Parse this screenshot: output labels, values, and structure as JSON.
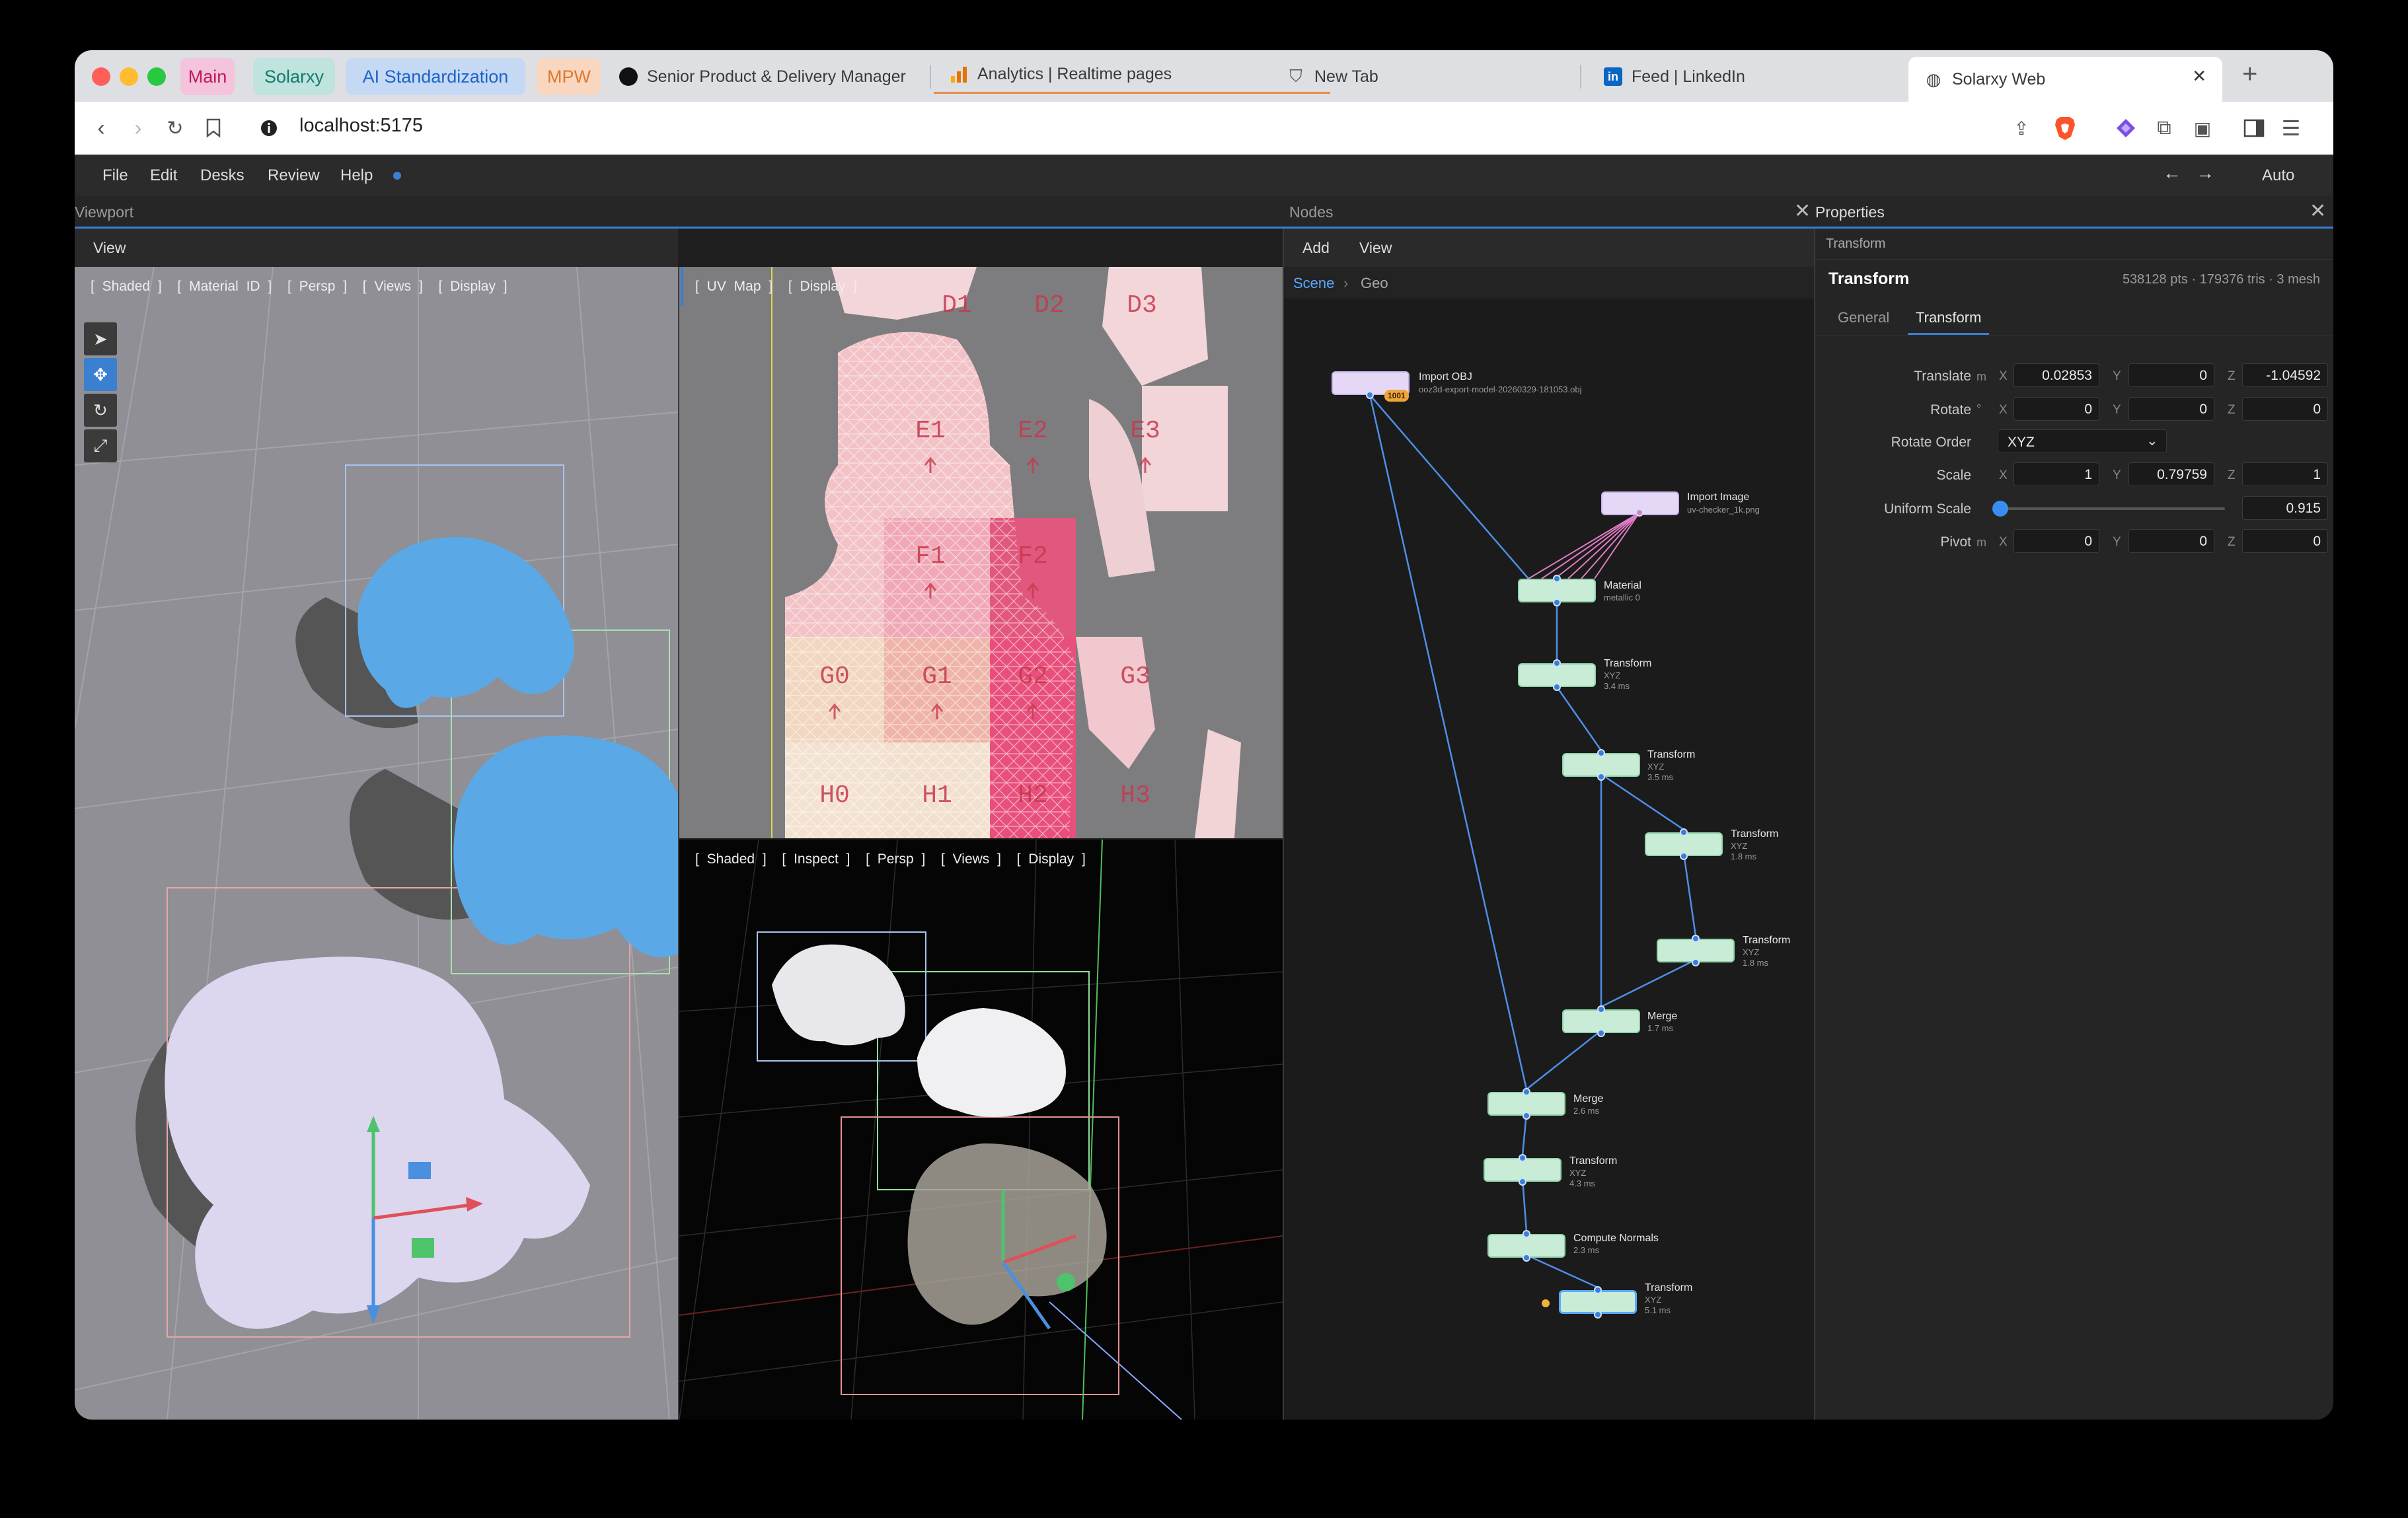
{
  "browser": {
    "tab_groups": [
      {
        "label": "Main",
        "bg": "#f3c4dc",
        "fg": "#c2185b"
      },
      {
        "label": "Solarxy",
        "bg": "#bfe3dd",
        "fg": "#127a6e"
      },
      {
        "label": "AI Standardization",
        "bg": "#c5d9f5",
        "fg": "#1e63c6"
      },
      {
        "label": "MPW",
        "bg": "#f8d6bf",
        "fg": "#e0782d"
      }
    ],
    "tabs": [
      {
        "label": "Senior Product & Delivery Manager"
      },
      {
        "label": "Analytics | Realtime pages"
      },
      {
        "label": "New Tab"
      },
      {
        "label": "Feed | LinkedIn"
      },
      {
        "label": "Solarxy Web"
      }
    ],
    "new_tab": "+",
    "close": "✕",
    "url": "localhost:5175"
  },
  "app": {
    "menu": [
      "File",
      "Edit",
      "Desks",
      "Review",
      "Help"
    ],
    "auto": "Auto",
    "panels": {
      "viewport_title": "Viewport",
      "nodes_title": "Nodes",
      "properties_title": "Properties"
    },
    "viewport_menu": "View",
    "nodes_menu": [
      "Add",
      "View"
    ],
    "breadcrumb": [
      "Scene",
      "Geo"
    ],
    "vp_main_bar": "[ Shaded ]  [ Material ID ]  [ Persp ]  [ Views ]  [ Display ]",
    "vp_uv_bar": "[ UV Map ]  [ Display ]",
    "vp_dark_bar": "[ Shaded ]  [ Inspect ]  [ Persp ]  [ Views ]  [ Display ]",
    "uv_tiles": [
      "D1",
      "D2",
      "D3",
      "E1",
      "E2",
      "E3",
      "F1",
      "F2",
      "G0",
      "G1",
      "G2",
      "G3",
      "H0",
      "H1",
      "H2",
      "H3"
    ]
  },
  "nodes": [
    {
      "id": "import_obj",
      "title": "Import OBJ",
      "sub": "ooz3d-export-model-20260329-181053.obj",
      "badge": "1001"
    },
    {
      "id": "import_image",
      "title": "Import Image",
      "sub": "uv-checker_1k.png"
    },
    {
      "id": "material",
      "title": "Material",
      "sub": "metallic 0"
    },
    {
      "id": "t1",
      "title": "Transform",
      "sub": "XYZ",
      "time": "3.4 ms"
    },
    {
      "id": "t2",
      "title": "Transform",
      "sub": "XYZ",
      "time": "3.5 ms"
    },
    {
      "id": "t3",
      "title": "Transform",
      "sub": "XYZ",
      "time": "1.8 ms"
    },
    {
      "id": "t4",
      "title": "Transform",
      "sub": "XYZ",
      "time": "1.8 ms"
    },
    {
      "id": "merge1",
      "title": "Merge",
      "time": "1.7 ms"
    },
    {
      "id": "merge2",
      "title": "Merge",
      "time": "2.6 ms"
    },
    {
      "id": "t5",
      "title": "Transform",
      "sub": "XYZ",
      "time": "4.3 ms"
    },
    {
      "id": "normals",
      "title": "Compute Normals",
      "time": "2.3 ms"
    },
    {
      "id": "t6",
      "title": "Transform",
      "sub": "XYZ",
      "time": "5.1 ms"
    }
  ],
  "properties": {
    "crumb": "Transform",
    "title": "Transform",
    "stats": "538128 pts · 179376 tris · 3 mesh",
    "tabs": [
      "General",
      "Transform"
    ],
    "active_tab": "Transform",
    "translate": {
      "label": "Translate",
      "unit": "m",
      "x": "0.02853",
      "y": "0",
      "z": "-1.04592"
    },
    "rotate": {
      "label": "Rotate",
      "unit": "°",
      "x": "0",
      "y": "0",
      "z": "0"
    },
    "rotate_order": {
      "label": "Rotate Order",
      "value": "XYZ"
    },
    "scale": {
      "label": "Scale",
      "x": "1",
      "y": "0.79759",
      "z": "1"
    },
    "uniform_scale": {
      "label": "Uniform Scale",
      "value": "0.915"
    },
    "pivot": {
      "label": "Pivot",
      "unit": "m",
      "x": "0",
      "y": "0",
      "z": "0"
    },
    "axes": [
      "X",
      "Y",
      "Z"
    ]
  }
}
